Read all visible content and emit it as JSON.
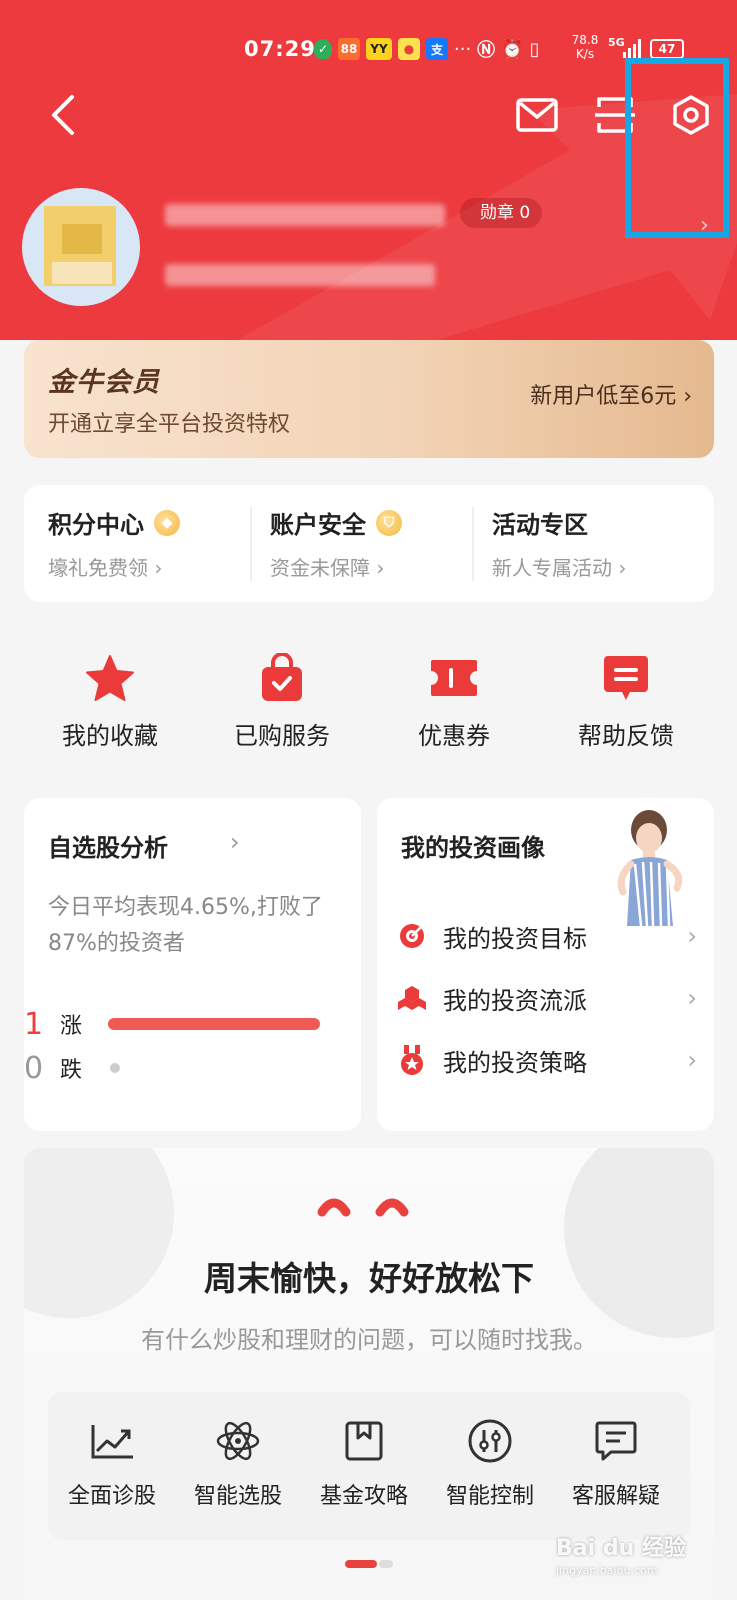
{
  "status_bar": {
    "time": "07:29",
    "network_speed": "78.8 K/s",
    "signal": "5G",
    "battery": "47"
  },
  "user": {
    "medal_label": "勋章 0"
  },
  "vip": {
    "title": "金牛会员",
    "subtitle": "开通立享全平台投资特权",
    "offer": "新用户低至6元 ›"
  },
  "account_strip": [
    {
      "title": "积分中心",
      "sub": "壕礼免费领 ›"
    },
    {
      "title": "账户安全",
      "sub": "资金未保障 ›"
    },
    {
      "title": "活动专区",
      "sub": "新人专属活动 ›"
    }
  ],
  "quick_actions": [
    {
      "label": "我的收藏",
      "icon": "star-icon"
    },
    {
      "label": "已购服务",
      "icon": "shopping-bag-icon"
    },
    {
      "label": "优惠券",
      "icon": "coupon-icon"
    },
    {
      "label": "帮助反馈",
      "icon": "feedback-icon"
    }
  ],
  "stock_analysis": {
    "title": "自选股分析",
    "chevron": "›",
    "description": "今日平均表现4.65%,打败了87%的投资者",
    "rise_count": "1",
    "rise_label": "涨",
    "fall_count": "0",
    "fall_label": "跌"
  },
  "investment_profile": {
    "title": "我的投资画像",
    "items": [
      {
        "label": "我的投资目标",
        "icon": "target-icon"
      },
      {
        "label": "我的投资流派",
        "icon": "cubes-icon"
      },
      {
        "label": "我的投资策略",
        "icon": "medal-icon"
      }
    ]
  },
  "assistant": {
    "title": "周末愉快，好好放松下",
    "subtitle": "有什么炒股和理财的问题，可以随时找我。",
    "tools": [
      {
        "label": "全面诊股",
        "icon": "trend-chart-icon"
      },
      {
        "label": "智能选股",
        "icon": "atom-icon"
      },
      {
        "label": "基金攻略",
        "icon": "bookmark-icon"
      },
      {
        "label": "智能控制",
        "icon": "sliders-icon"
      },
      {
        "label": "客服解疑",
        "icon": "message-icon"
      }
    ]
  },
  "watermark": {
    "brand": "Bai du 经验",
    "url": "jingyan.baidu.com"
  },
  "colors": {
    "header_red": "#ec3a3f",
    "accent_red": "#e8413e",
    "highlight_blue": "#16a8e6",
    "vip_gold": "#f2d3b5"
  }
}
